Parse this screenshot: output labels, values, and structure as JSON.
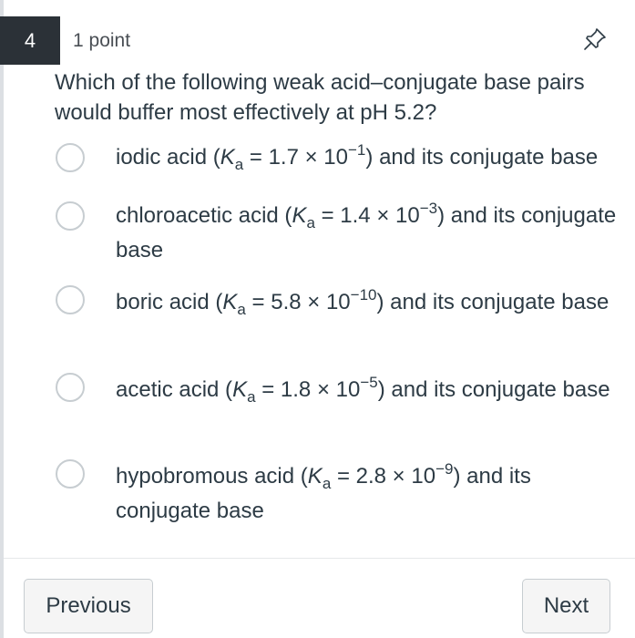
{
  "question": {
    "number": "4",
    "points": "1 point",
    "pin_icon": "pin-icon",
    "text": "Which of the following weak acid–conjugate base pairs would buffer most effectively at pH 5.2?"
  },
  "options": [
    {
      "acid": "iodic acid",
      "k": "K",
      "k_sub": "a",
      "mantissa": "1.7",
      "exponent": "−1",
      "suffix": "and its conjugate base"
    },
    {
      "acid": "chloroacetic acid",
      "k": "K",
      "k_sub": "a",
      "mantissa": "1.4",
      "exponent": "−3",
      "suffix": "and its conjugate base"
    },
    {
      "acid": "boric acid",
      "k": "K",
      "k_sub": "a",
      "mantissa": "5.8",
      "exponent": "−10",
      "suffix": "and its conjugate base"
    },
    {
      "acid": "acetic acid",
      "k": "K",
      "k_sub": "a",
      "mantissa": "1.8",
      "exponent": "−5",
      "suffix": "and its conjugate base"
    },
    {
      "acid": "hypobromous acid",
      "k": "K",
      "k_sub": "a",
      "mantissa": "2.8",
      "exponent": "−9",
      "suffix": "and its conjugate base"
    }
  ],
  "nav": {
    "previous_label": "Previous",
    "next_label": "Next"
  }
}
